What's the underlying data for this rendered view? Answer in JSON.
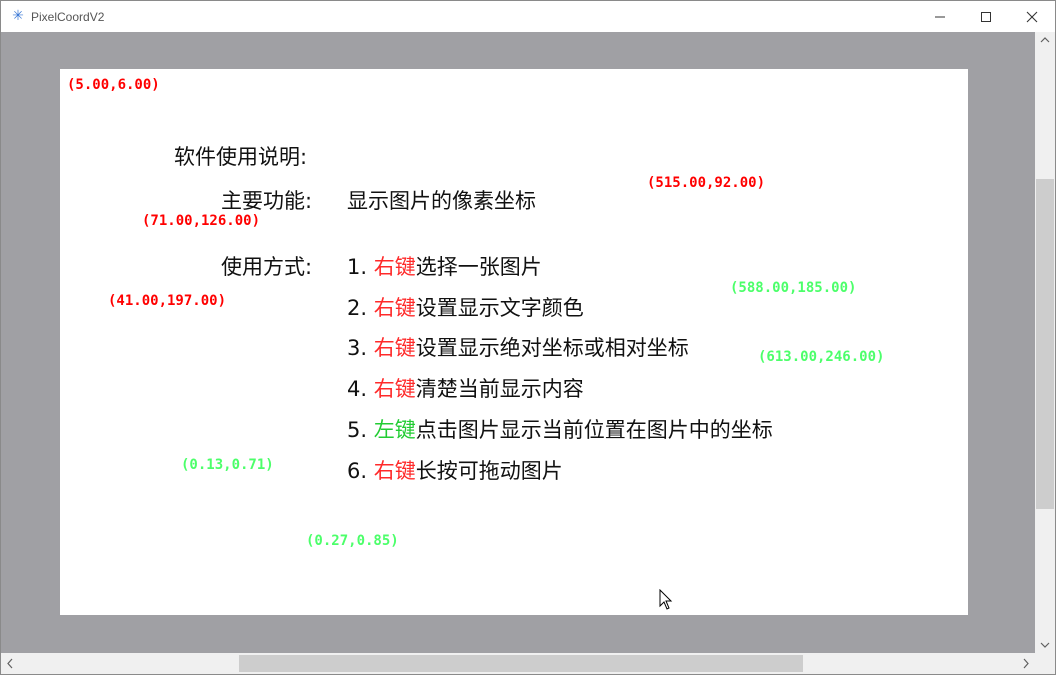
{
  "window": {
    "title": "PixelCoordV2",
    "icon": "snowflake-icon"
  },
  "coords": {
    "c1": "(5.00,6.00)",
    "c2": "(515.00,92.00)",
    "c3": "(71.00,126.00)",
    "c4": "(588.00,185.00)",
    "c5": "(41.00,197.00)",
    "c6": "(613.00,246.00)",
    "c7": "(0.13,0.71)",
    "c8": "(0.27,0.85)"
  },
  "instructions": {
    "title": "软件使用说明:",
    "feature_label": "主要功能:",
    "feature_text": "显示图片的像素坐标",
    "usage_label": "使用方式:",
    "items": [
      {
        "num": "1. ",
        "key": "右键",
        "text": "选择一张图片"
      },
      {
        "num": "2. ",
        "key": "右键",
        "text": "设置显示文字颜色"
      },
      {
        "num": "3. ",
        "key": "右键",
        "text": "设置显示绝对坐标或相对坐标"
      },
      {
        "num": "4. ",
        "key": "右键",
        "text": "清楚当前显示内容"
      },
      {
        "num": "5. ",
        "key": "左键",
        "text": "点击图片显示当前位置在图片中的坐标"
      },
      {
        "num": "6. ",
        "key": "右键",
        "text": "长按可拖动图片"
      }
    ]
  },
  "colors": {
    "absolute_coord": "#ff0000",
    "relative_coord": "#4cff6a",
    "right_key": "#ff2a2a",
    "left_key": "#22cc33",
    "viewport_bg": "#a0a0a4"
  }
}
